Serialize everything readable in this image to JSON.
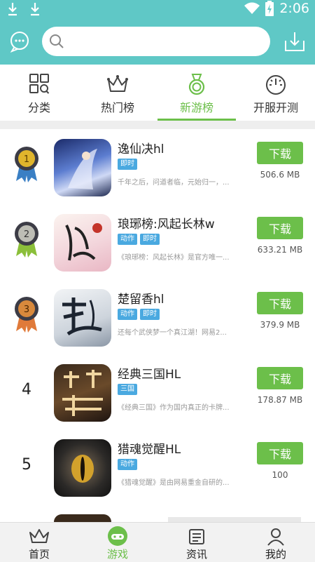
{
  "status_bar": {
    "time": "2:06"
  },
  "search": {
    "placeholder": ""
  },
  "tabs": [
    {
      "label": "分类",
      "icon": "grid-icon"
    },
    {
      "label": "热门榜",
      "icon": "crown-icon"
    },
    {
      "label": "新游榜",
      "icon": "medal-icon"
    },
    {
      "label": "开服开测",
      "icon": "gauge-icon"
    }
  ],
  "active_tab": "新游榜",
  "games": [
    {
      "rank": "1",
      "name": "逸仙决hl",
      "tags": [
        "即时"
      ],
      "desc": "千年之后，问道者临，元始归一，...",
      "size": "506.6 MB",
      "button": "下载"
    },
    {
      "rank": "2",
      "name": "琅琊榜:风起长林w",
      "tags": [
        "动作",
        "即时"
      ],
      "desc": "《琅琊榜：风起长林》是官方唯一...",
      "size": "633.21 MB",
      "button": "下载"
    },
    {
      "rank": "3",
      "name": "楚留香hl",
      "tags": [
        "动作",
        "即时"
      ],
      "desc": "还每个武侠梦一个真江湖！网易2...",
      "size": "379.9 MB",
      "button": "下载"
    },
    {
      "rank": "4",
      "name": "经典三国HL",
      "tags": [
        "三国"
      ],
      "desc": "《经典三国》作为国内真正的卡牌...",
      "size": "178.87 MB",
      "button": "下载"
    },
    {
      "rank": "5",
      "name": "猎魂觉醒HL",
      "tags": [
        "动作"
      ],
      "desc": "《猎魂觉醒》是由网易重金自研的...",
      "size": "100",
      "button": "下载"
    }
  ],
  "bottom_nav": [
    {
      "label": "首页",
      "icon": "crown-icon"
    },
    {
      "label": "游戏",
      "icon": "gamepad-icon"
    },
    {
      "label": "资讯",
      "icon": "news-icon"
    },
    {
      "label": "我的",
      "icon": "user-icon"
    }
  ],
  "colors": {
    "primary": "#5fc8c6",
    "accent_green": "#6cbf4a",
    "tag_blue": "#4aa9e0"
  }
}
